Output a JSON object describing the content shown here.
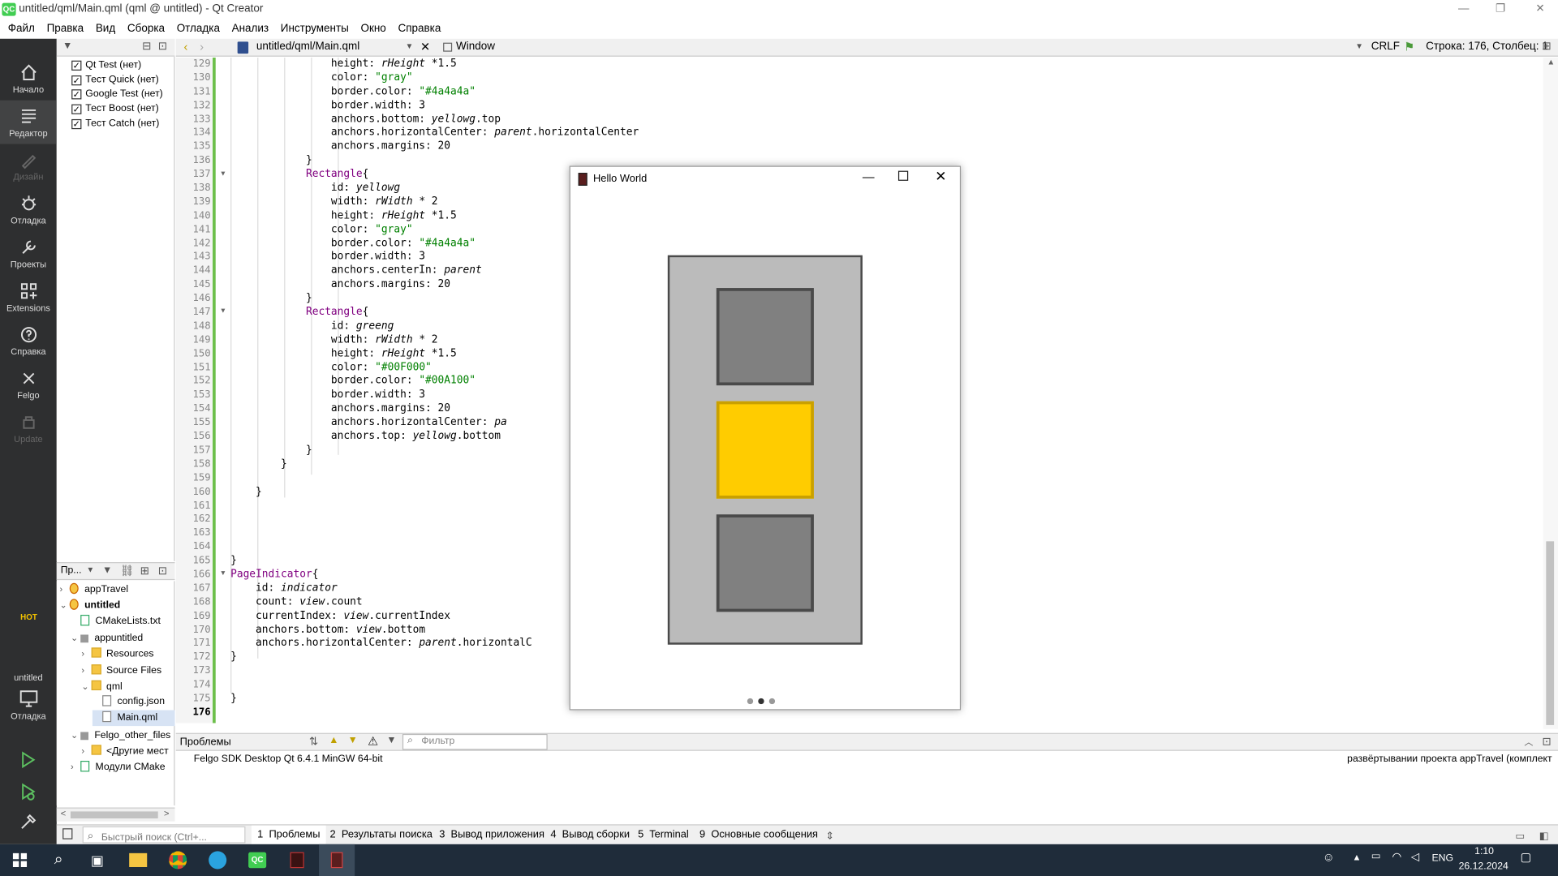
{
  "window": {
    "title": "untitled/qml/Main.qml (qml @ untitled) - Qt Creator",
    "logo": "QC"
  },
  "menu": [
    "Файл",
    "Правка",
    "Вид",
    "Сборка",
    "Отладка",
    "Анализ",
    "Инструменты",
    "Окно",
    "Справка"
  ],
  "modes": [
    {
      "label": "Начало",
      "icon": "home-icon"
    },
    {
      "label": "Редактор",
      "icon": "editor-icon"
    },
    {
      "label": "Дизайн",
      "icon": "design-icon"
    },
    {
      "label": "Отладка",
      "icon": "debug-icon"
    },
    {
      "label": "Проекты",
      "icon": "projects-icon"
    },
    {
      "label": "Extensions",
      "icon": "extensions-icon"
    },
    {
      "label": "Справка",
      "icon": "help-icon"
    },
    {
      "label": "Felgo",
      "icon": "felgo-icon"
    },
    {
      "label": "Update",
      "icon": "update-icon"
    }
  ],
  "kit": {
    "project": "untitled",
    "mode": "Отладка",
    "hot": "HOT"
  },
  "tests": [
    "Qt Test (нет)",
    "Тест Quick (нет)",
    "Google Test (нет)",
    "Тест Boost (нет)",
    "Тест Catch (нет)"
  ],
  "projects_header": "Пр...",
  "tree": [
    {
      "label": "appTravel",
      "indent": 0,
      "arrow": ">",
      "icon": "qml"
    },
    {
      "label": "untitled",
      "indent": 0,
      "arrow": "v",
      "icon": "qml",
      "bold": true
    },
    {
      "label": "CMakeLists.txt",
      "indent": 1,
      "arrow": "",
      "icon": "cmake"
    },
    {
      "label": "appuntitled",
      "indent": 1,
      "arrow": "v",
      "icon": "target"
    },
    {
      "label": "Resources",
      "indent": 2,
      "arrow": ">",
      "icon": "folder"
    },
    {
      "label": "Source Files",
      "indent": 2,
      "arrow": ">",
      "icon": "folder"
    },
    {
      "label": "qml",
      "indent": 2,
      "arrow": "v",
      "icon": "folder"
    },
    {
      "label": "config.json",
      "indent": 3,
      "arrow": "",
      "icon": "file"
    },
    {
      "label": "Main.qml",
      "indent": 3,
      "arrow": "",
      "icon": "file",
      "selected": true
    },
    {
      "label": "Felgo_other_files",
      "indent": 1,
      "arrow": "v",
      "icon": "target"
    },
    {
      "label": "<Другие мест",
      "indent": 2,
      "arrow": ">",
      "icon": "folder"
    },
    {
      "label": "Модули CMake",
      "indent": 1,
      "arrow": ">",
      "icon": "cmake"
    }
  ],
  "editor": {
    "file": "untitled/qml/Main.qml",
    "symbol": "Window",
    "line_ending": "CRLF",
    "position": "Строка: 176, Столбец: 1"
  },
  "line_start": 129,
  "code": [
    "                height: §rHeight§ *1.5",
    "                color: \"gray\"",
    "                border.color: \"#4a4a4a\"",
    "                border.width: 3",
    "                anchors.bottom: §yellowg§.top",
    "                anchors.horizontalCenter: §parent§.horizontalCenter",
    "                anchors.margins: 20",
    "            }",
    "            Rectangle{",
    "                id: §yellowg§",
    "                width: §rWidth§ * 2",
    "                height: §rHeight§ *1.5",
    "                color: \"gray\"",
    "                border.color: \"#4a4a4a\"",
    "                border.width: 3",
    "                anchors.centerIn: §parent§",
    "                anchors.margins: 20",
    "            }",
    "            Rectangle{",
    "                id: §greeng§",
    "                width: §rWidth§ * 2",
    "                height: §rHeight§ *1.5",
    "                color: \"#00F000\"",
    "                border.color: \"#00A100\"",
    "                border.width: 3",
    "                anchors.margins: 20",
    "                anchors.horizontalCenter: §pa§",
    "                anchors.top: §yellowg§.bottom",
    "            }",
    "        }",
    "",
    "    }",
    "",
    "",
    "",
    "",
    "}",
    "PageIndicator{",
    "    id: §indicator§",
    "    count: §view§.count",
    "    currentIndex: §view§.currentIndex",
    "    anchors.bottom: §view§.bottom",
    "    anchors.horizontalCenter: §parent§.horizontalC",
    "}",
    "",
    "",
    "}",
    ""
  ],
  "dialog": {
    "title": "Hello World",
    "colors": {
      "top": "#808080",
      "middle": "#FFCC00",
      "bottom": "#808080",
      "frame": "#BBBBBB",
      "border": "#4A4A4A"
    },
    "page_count": 3,
    "current_page": 1
  },
  "problems": {
    "title": "Проблемы",
    "filter_placeholder": "Фильтр",
    "kit": "Felgo SDK Desktop Qt 6.4.1 MinGW 64-bit",
    "message": "развёртывании проекта appTravel (комплект"
  },
  "status": {
    "search_placeholder": "Быстрый поиск (Ctrl+...",
    "tabs": [
      "1  Проблемы",
      "2  Результаты поиска",
      "3  Вывод приложения",
      "4  Вывод сборки",
      "5  Terminal",
      "9  Основные сообщения"
    ]
  },
  "taskbar": {
    "time": "1:10",
    "date": "26.12.2024",
    "lang": "ENG"
  }
}
